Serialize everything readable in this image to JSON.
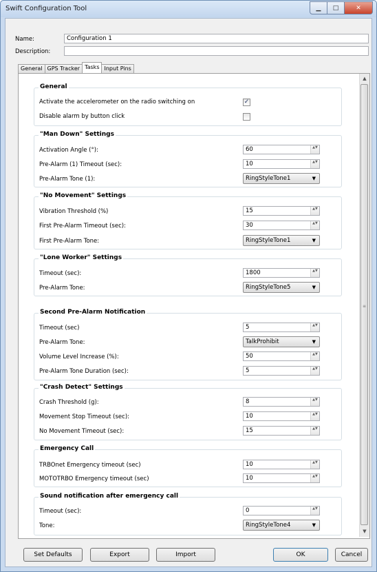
{
  "window": {
    "title": "Swift Configuration Tool",
    "min_glyph": "▁",
    "max_glyph": "□",
    "close_glyph": "✕"
  },
  "form": {
    "name_label": "Name:",
    "name_value": "Configuration 1",
    "description_label": "Description:",
    "description_value": ""
  },
  "tabs": [
    {
      "label": "General"
    },
    {
      "label": "GPS Tracker"
    },
    {
      "label": "Tasks",
      "active": true
    },
    {
      "label": "Input Pins"
    }
  ],
  "groups": {
    "general": {
      "title": "General",
      "rows": [
        {
          "label": "Activate the accelerometer on the radio switching on",
          "checked": true,
          "mark": "✓"
        },
        {
          "label": "Disable alarm by button click",
          "checked": false,
          "mark": ""
        }
      ]
    },
    "man_down": {
      "title": "\"Man Down\" Settings",
      "rows": [
        {
          "label": "Activation Angle (°):",
          "value": "60"
        },
        {
          "label": "Pre-Alarm (1) Timeout (sec):",
          "value": "10"
        },
        {
          "label": "Pre-Alarm Tone (1):",
          "value": "RingStyleTone1"
        }
      ]
    },
    "no_movement": {
      "title": "\"No Movement\" Settings",
      "rows": [
        {
          "label": "Vibration Threshold (%)",
          "value": "15"
        },
        {
          "label": "First Pre-Alarm Timeout (sec):",
          "value": "30"
        },
        {
          "label": "First Pre-Alarm Tone:",
          "value": "RingStyleTone1"
        }
      ]
    },
    "lone_worker": {
      "title": "\"Lone Worker\" Settings",
      "rows": [
        {
          "label": "Timeout (sec):",
          "value": "1800"
        },
        {
          "label": "Pre-Alarm Tone:",
          "value": "RingStyleTone5"
        }
      ]
    },
    "second_pre_alarm": {
      "title": "Second Pre-Alarm Notification",
      "rows": [
        {
          "label": "Timeout (sec)",
          "value": "5"
        },
        {
          "label": "Pre-Alarm Tone:",
          "value": "TalkProhibit"
        },
        {
          "label": "Volume Level Increase (%):",
          "value": "50"
        },
        {
          "label": "Pre-Alarm Tone Duration (sec):",
          "value": "5"
        }
      ]
    },
    "crash_detect": {
      "title": "\"Crash Detect\" Settings",
      "rows": [
        {
          "label": "Crash Threshold (g):",
          "value": "8"
        },
        {
          "label": "Movement Stop Timeout (sec):",
          "value": "10"
        },
        {
          "label": "No Movement Timeout (sec):",
          "value": "15"
        }
      ]
    },
    "emergency_call": {
      "title": "Emergency Call",
      "rows": [
        {
          "label": "TRBOnet Emergency timeout (sec)",
          "value": "10"
        },
        {
          "label": "MOTOTRBO Emergency timeout (sec)",
          "value": "10"
        }
      ]
    },
    "sound_notification": {
      "title": "Sound notification after emergency call",
      "rows": [
        {
          "label": "Timeout (sec):",
          "value": "0"
        },
        {
          "label": "Tone:",
          "value": "RingStyleTone4"
        }
      ]
    }
  },
  "glyphs": {
    "spin": "▲▼",
    "dropdown": "▼",
    "scroll_up": "▲",
    "scroll_down": "▼",
    "grip": "≡"
  },
  "buttons": {
    "set_defaults": "Set Defaults",
    "export": "Export",
    "import": "Import",
    "ok": "OK",
    "cancel": "Cancel"
  }
}
